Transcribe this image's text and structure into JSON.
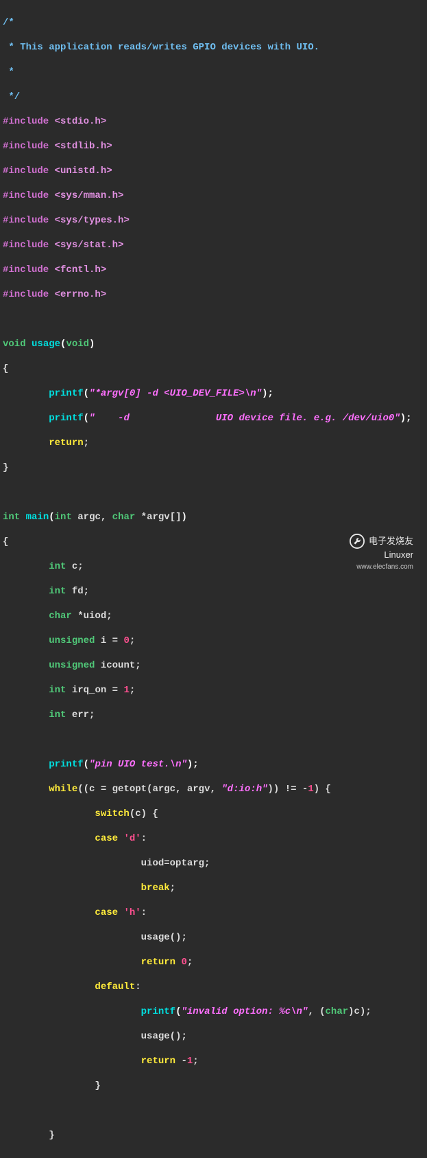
{
  "colors": {
    "background": "#2b2b2b",
    "comment": "#6fbef0",
    "preprocessor": "#d070d0",
    "keyword_type": "#50c878",
    "keyword_control": "#ffeb3b",
    "function": "#00e0e0",
    "string": "#ff70ff",
    "number": "#ff5090",
    "plain": "#dcdcdc"
  },
  "code": {
    "comment": {
      "l1": "/*",
      "l2": " * This application reads/writes GPIO devices with UIO.",
      "l3": " *",
      "l4": " */"
    },
    "includes": {
      "kw": "#include",
      "i1": "<stdio.h>",
      "i2": "<stdlib.h>",
      "i3": "<unistd.h>",
      "i4": "<sys/mman.h>",
      "i5": "<sys/types.h>",
      "i6": "<sys/stat.h>",
      "i7": "<fcntl.h>",
      "i8": "<errno.h>"
    },
    "usage": {
      "ret": "void",
      "name": "usage",
      "param_type": "void",
      "open": "{",
      "p1_call": "printf",
      "p1_str": "\"*argv[0] -d <UIO_DEV_FILE>\\n\"",
      "p2_call": "printf",
      "p2_str": "\"    -d               UIO device file. e.g. /dev/uio0\"",
      "ret_stmt": "return",
      "close": "}"
    },
    "main": {
      "ret": "int",
      "name": "main",
      "param_int": "int",
      "argc": " argc, ",
      "param_char": "char",
      "argv": " *argv[]",
      "open": "{",
      "d1_t": "int",
      "d1_v": " c;",
      "d2_t": "int",
      "d2_v": " fd;",
      "d3_t": "char",
      "d3_v": " *uiod;",
      "d4_t": "unsigned",
      "d4_v": " i = ",
      "d4_n": "0",
      "d5_t": "unsigned",
      "d5_v": " icount;",
      "d6_t": "int",
      "d6_v": " irq_on = ",
      "d6_n": "1",
      "d7_t": "int",
      "d7_v": " err;",
      "pr_call": "printf",
      "pr_str": "\"pin UIO test.\\n\"",
      "while_kw": "while",
      "while_pre": "((c = getopt(argc, argv, ",
      "while_str": "\"d:io:h\"",
      "while_mid": ")) != -",
      "while_n": "1",
      "while_post": ") {",
      "switch_kw": "switch",
      "switch_arg": "(c) {",
      "case_kw": "case",
      "case_d": "'d'",
      "case_d_body": "uiod=optarg;",
      "break_kw": "break",
      "case_h": "'h'",
      "usage_call": "usage();",
      "return_kw": "return",
      "ret0": "0",
      "default_kw": "default",
      "def_pr": "printf",
      "def_str": "\"invalid option: %c\\n\"",
      "def_cast_paren": ", (",
      "def_cast": "char",
      "def_cast_end": ")c);",
      "retm1": "1",
      "close1": "}",
      "close2": "}"
    }
  },
  "watermark": {
    "brand": "电子发烧友",
    "source": "Linuxer",
    "url": "www.elecfans.com"
  }
}
